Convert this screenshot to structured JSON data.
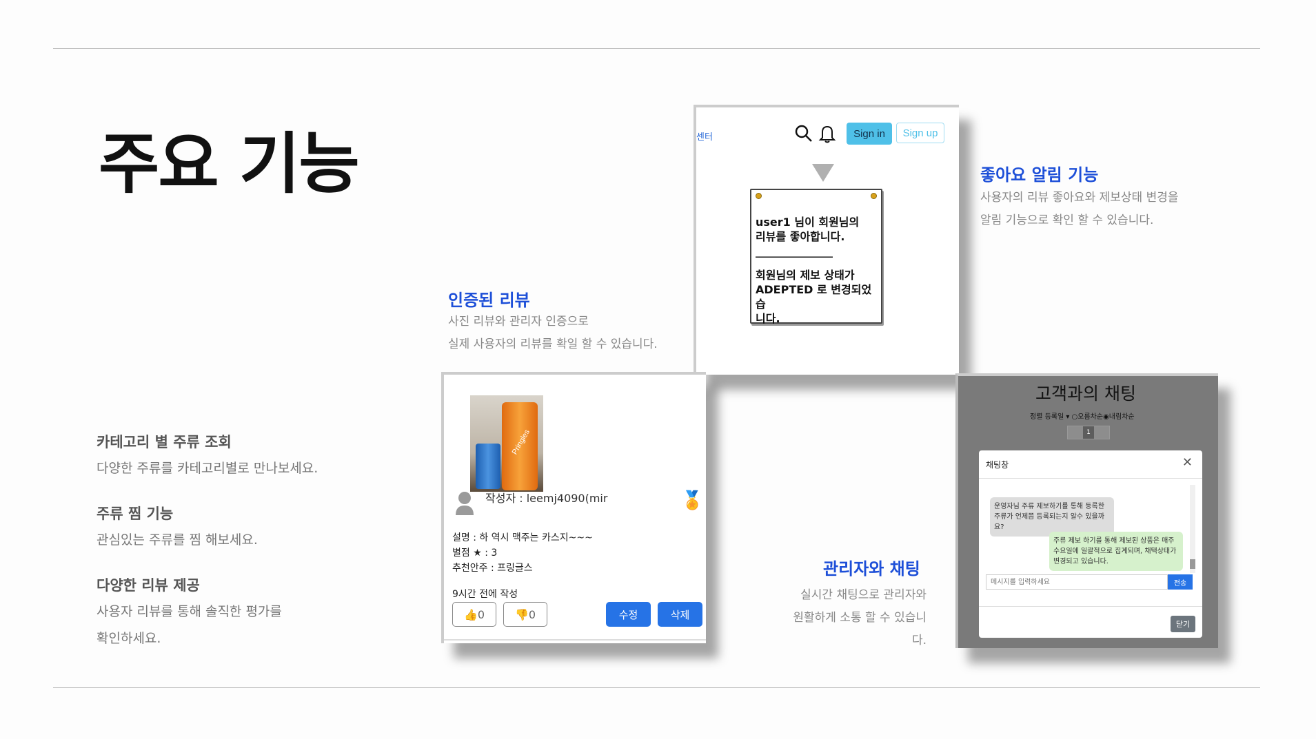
{
  "page": {
    "title": "주요 기능"
  },
  "features": [
    {
      "heading": "카테고리 별 주류 조회",
      "desc": "다양한 주류를 카테고리별로 만나보세요."
    },
    {
      "heading": "주류 찜 기능",
      "desc": "관심있는 주류를 찜 해보세요."
    },
    {
      "heading": "다양한 리뷰 제공",
      "desc": "사용자 리뷰를 통해 솔직한 평가를\n확인하세요."
    }
  ],
  "verified_review": {
    "heading": "인증된 리뷰",
    "desc": "사진 리뷰와 관리자 인증으로\n실제 사용자의 리뷰를 확일 할 수 있습니다."
  },
  "like_alert": {
    "heading": "좋아요 알림 기능",
    "desc": "사용자의 리뷰 좋아요와 제보상태 변경을\n알림 기능으로 확인 할 수 있습니다."
  },
  "admin_chat": {
    "heading": "관리자와 채팅",
    "desc": "실시간 채팅으로 관리자와\n원활하게 소통 할 수 있습니다."
  },
  "notif_screen": {
    "nav_fragment": "센터",
    "signin": "Sign in",
    "signup": "Sign up",
    "message_1": "user1 님이 회원님의\n리뷰를 좋아합니다.",
    "divider": "______________",
    "message_2": "회원님의 제보 상태가\nADEPTED 로 변경되었습\n니다."
  },
  "review_screen": {
    "product_text": "Pringles",
    "author": "작성자 : leemj4090(mir",
    "description": "설명 : 하 역시 맥주는 카스지~~~",
    "rating": "별점 ★ : 3",
    "pairing": "추천안주 : 프링글스",
    "time": "9시간 전에 작성",
    "like_count": "0",
    "dislike_count": "0",
    "edit": "수정",
    "delete": "삭제"
  },
  "chat_screen": {
    "title": "고객과의 채팅",
    "sort": "정렬 등록일 ▾  ○오름차순◉내림차순",
    "page": "1",
    "modal_title": "채팅창",
    "msg_user": "운영자님 주류 제보하기를 통해 등록한 주류가 언제쯤 등록되는지 알수 있을까요?",
    "msg_admin": "주류 제보 하기를 통해 제보된 상품은 매주 수요일에 일괄적으로 집계되며, 채택상태가 변경되고 있습니다.",
    "input_placeholder": "메시지를 입력하세요",
    "send": "전송",
    "close": "닫기"
  },
  "colors": {
    "accent_blue": "#1d4fd8",
    "signin_bg": "#4fc0e8",
    "button_blue": "#2673e6"
  }
}
